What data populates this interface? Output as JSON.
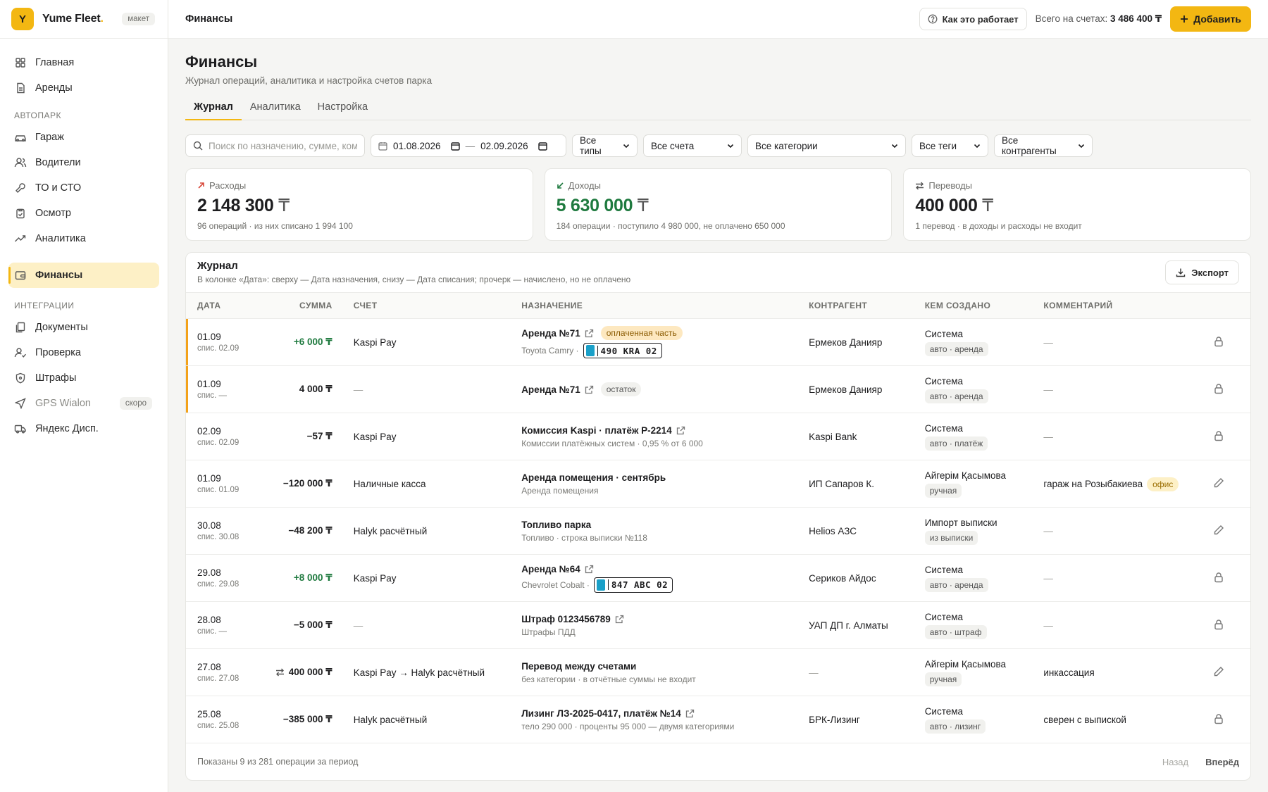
{
  "brand": {
    "letter": "Y",
    "name": "Yume Fleet",
    "badge": "макет"
  },
  "nav": {
    "main": [
      {
        "label": "Главная",
        "icon": "grid-icon"
      },
      {
        "label": "Аренды",
        "icon": "doc-icon"
      }
    ],
    "fleet_section": "АВТОПАРК",
    "fleet": [
      {
        "label": "Гараж",
        "icon": "car-icon"
      },
      {
        "label": "Водители",
        "icon": "users-icon"
      },
      {
        "label": "ТО и СТО",
        "icon": "wrench-icon"
      },
      {
        "label": "Осмотр",
        "icon": "clipboard-icon"
      },
      {
        "label": "Аналитика",
        "icon": "trend-icon"
      }
    ],
    "finance": {
      "label": "Финансы",
      "icon": "wallet-icon"
    },
    "integrations_section": "ИНТЕГРАЦИИ",
    "integrations": [
      {
        "label": "Документы",
        "icon": "files-icon"
      },
      {
        "label": "Проверка",
        "icon": "user-check-icon"
      },
      {
        "label": "Штрафы",
        "icon": "shield-icon"
      },
      {
        "label": "GPS Wialon",
        "icon": "navigation-icon",
        "badge": "скоро"
      },
      {
        "label": "Яндекс Дисп.",
        "icon": "truck-icon"
      }
    ]
  },
  "topbar": {
    "title": "Финансы",
    "how_it_works": "Как это работает",
    "total_label": "Всего на счетах:",
    "total_value": "3 486 400 ₸",
    "add_button": "Добавить"
  },
  "page": {
    "title": "Финансы",
    "subtitle": "Журнал операций, аналитика и настройка счетов парка"
  },
  "tabs": [
    "Журнал",
    "Аналитика",
    "Настройка"
  ],
  "filters": {
    "search_placeholder": "Поиск по назначению, сумме, комментарию",
    "date_from": "01.08.2026",
    "date_to": "02.09.2026",
    "date_sep": "—",
    "types": "Все типы",
    "accounts": "Все счета",
    "categories": "Все категории",
    "tags": "Все теги",
    "counterparties": "Все контрагенты"
  },
  "cards": {
    "expenses": {
      "label": "Расходы",
      "value": "2 148 300",
      "currency": "₸",
      "note": "96 операций · из них списано 1 994 100",
      "color": "#d8483a"
    },
    "income": {
      "label": "Доходы",
      "value": "5 630 000",
      "currency": "₸",
      "note": "184 операции · поступило 4 980 000, не оплачено 650 000",
      "color": "#1f7a3f"
    },
    "transfers": {
      "label": "Переводы",
      "value": "400 000",
      "currency": "₸",
      "note": "1 перевод · в доходы и расходы не входит"
    }
  },
  "journal": {
    "title": "Журнал",
    "subtitle": "В колонке «Дата»: сверху — Дата назначения, снизу — Дата списания; прочерк — начислено, но не оплачено",
    "export": "Экспорт",
    "columns": [
      "Дата",
      "Сумма",
      "Счет",
      "Назначение",
      "Контрагент",
      "Кем создано",
      "Комментарий"
    ],
    "rows": [
      {
        "date": "01.09",
        "charge": "спис. 02.09",
        "amount": "+6 000 ₸",
        "kind": "pos",
        "account": "Kaspi Pay",
        "purpose": "Аренда №71",
        "link": true,
        "badge": "оплаченная часть",
        "badge_kind": "paid",
        "sub": "Toyota Camry ·",
        "plate": "490 KRA 02",
        "counterparty": "Ермеков Данияр",
        "creator": "Система",
        "tag": "авто · аренда",
        "comment": "—",
        "action": "lock",
        "pending": true
      },
      {
        "date": "01.09",
        "charge": "спис. —",
        "amount": "4 000 ₸",
        "kind": "neutral",
        "account": "—",
        "purpose": "Аренда №71",
        "link": true,
        "badge": "остаток",
        "badge_kind": "rest",
        "sub": "",
        "plate": "",
        "counterparty": "Ермеков Данияр",
        "creator": "Система",
        "tag": "авто · аренда",
        "comment": "—",
        "action": "lock",
        "pending": true
      },
      {
        "date": "02.09",
        "charge": "спис. 02.09",
        "amount": "−57 ₸",
        "kind": "neutral",
        "account": "Kaspi Pay",
        "purpose": "Комиссия Kaspi · платёж P-2214",
        "link": true,
        "badge": "",
        "badge_kind": "",
        "sub": "Комиссии платёжных систем · 0,95 % от 6 000",
        "plate": "",
        "counterparty": "Kaspi Bank",
        "creator": "Система",
        "tag": "авто · платёж",
        "comment": "—",
        "action": "lock",
        "pending": false
      },
      {
        "date": "01.09",
        "charge": "спис. 01.09",
        "amount": "−120 000 ₸",
        "kind": "neutral",
        "account": "Наличные касса",
        "purpose": "Аренда помещения · сентябрь",
        "link": false,
        "badge": "",
        "badge_kind": "",
        "sub": "Аренда помещения",
        "plate": "",
        "counterparty": "ИП Сапаров К.",
        "creator": "Айгерім Қасымова",
        "tag": "ручная",
        "comment": "гараж на Розыбакиева",
        "comment_badge": "офис",
        "action": "edit",
        "pending": false
      },
      {
        "date": "30.08",
        "charge": "спис. 30.08",
        "amount": "−48 200 ₸",
        "kind": "neutral",
        "account": "Halyk расчётный",
        "purpose": "Топливо парка",
        "link": false,
        "badge": "",
        "badge_kind": "",
        "sub": "Топливо · строка выписки №118",
        "plate": "",
        "counterparty": "Helios АЗС",
        "creator": "Импорт выписки",
        "tag": "из выписки",
        "comment": "—",
        "action": "edit",
        "pending": false
      },
      {
        "date": "29.08",
        "charge": "спис. 29.08",
        "amount": "+8 000 ₸",
        "kind": "pos",
        "account": "Kaspi Pay",
        "purpose": "Аренда №64",
        "link": true,
        "badge": "",
        "badge_kind": "",
        "sub": "Chevrolet Cobalt ·",
        "plate": "847 ABC 02",
        "counterparty": "Сериков Айдос",
        "creator": "Система",
        "tag": "авто · аренда",
        "comment": "—",
        "action": "lock",
        "pending": false
      },
      {
        "date": "28.08",
        "charge": "спис. —",
        "amount": "−5 000 ₸",
        "kind": "neutral",
        "account": "—",
        "purpose": "Штраф 0123456789",
        "link": true,
        "badge": "",
        "badge_kind": "",
        "sub": "Штрафы ПДД",
        "plate": "",
        "counterparty": "УАП ДП г. Алматы",
        "creator": "Система",
        "tag": "авто · штраф",
        "comment": "—",
        "action": "lock",
        "pending": false
      },
      {
        "date": "27.08",
        "charge": "спис. 27.08",
        "amount": "400 000 ₸",
        "kind": "transfer",
        "account": "Kaspi Pay → Halyk расчётный",
        "purpose": "Перевод между счетами",
        "link": false,
        "badge": "",
        "badge_kind": "",
        "sub": "без категории · в отчётные суммы не входит",
        "plate": "",
        "counterparty": "—",
        "creator": "Айгерім Қасымова",
        "tag": "ручная",
        "comment": "инкассация",
        "action": "edit",
        "pending": false
      },
      {
        "date": "25.08",
        "charge": "спис. 25.08",
        "amount": "−385 000 ₸",
        "kind": "neutral",
        "account": "Halyk расчётный",
        "purpose": "Лизинг ЛЗ-2025-0417, платёж №14",
        "link": true,
        "badge": "",
        "badge_kind": "",
        "sub": "тело 290 000 · проценты 95 000 — двумя категориями",
        "plate": "",
        "counterparty": "БРК-Лизинг",
        "creator": "Система",
        "tag": "авто · лизинг",
        "comment": "сверен с выпиской",
        "action": "lock",
        "pending": false
      }
    ],
    "footer": "Показаны 9 из 281 операции за период",
    "prev": "Назад",
    "next": "Вперёд"
  },
  "colors": {
    "accent": "#f3b712",
    "positive": "#1f7a3f",
    "pending_stripe": "#f3a21a"
  }
}
